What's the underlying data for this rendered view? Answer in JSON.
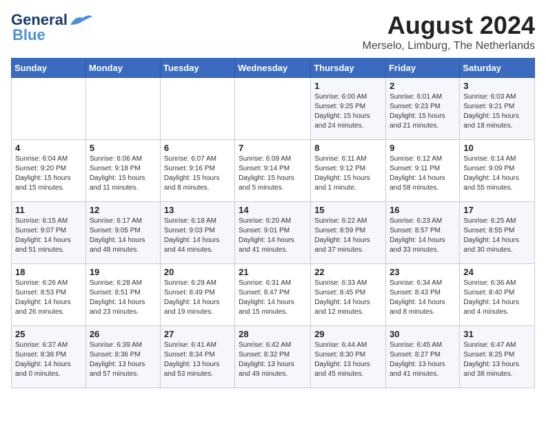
{
  "header": {
    "logo_line1": "General",
    "logo_line2": "Blue",
    "title": "August 2024",
    "subtitle": "Merselo, Limburg, The Netherlands"
  },
  "weekdays": [
    "Sunday",
    "Monday",
    "Tuesday",
    "Wednesday",
    "Thursday",
    "Friday",
    "Saturday"
  ],
  "weeks": [
    [
      {
        "day": "",
        "info": ""
      },
      {
        "day": "",
        "info": ""
      },
      {
        "day": "",
        "info": ""
      },
      {
        "day": "",
        "info": ""
      },
      {
        "day": "1",
        "info": "Sunrise: 6:00 AM\nSunset: 9:25 PM\nDaylight: 15 hours\nand 24 minutes."
      },
      {
        "day": "2",
        "info": "Sunrise: 6:01 AM\nSunset: 9:23 PM\nDaylight: 15 hours\nand 21 minutes."
      },
      {
        "day": "3",
        "info": "Sunrise: 6:03 AM\nSunset: 9:21 PM\nDaylight: 15 hours\nand 18 minutes."
      }
    ],
    [
      {
        "day": "4",
        "info": "Sunrise: 6:04 AM\nSunset: 9:20 PM\nDaylight: 15 hours\nand 15 minutes."
      },
      {
        "day": "5",
        "info": "Sunrise: 6:06 AM\nSunset: 9:18 PM\nDaylight: 15 hours\nand 11 minutes."
      },
      {
        "day": "6",
        "info": "Sunrise: 6:07 AM\nSunset: 9:16 PM\nDaylight: 15 hours\nand 8 minutes."
      },
      {
        "day": "7",
        "info": "Sunrise: 6:09 AM\nSunset: 9:14 PM\nDaylight: 15 hours\nand 5 minutes."
      },
      {
        "day": "8",
        "info": "Sunrise: 6:11 AM\nSunset: 9:12 PM\nDaylight: 15 hours\nand 1 minute."
      },
      {
        "day": "9",
        "info": "Sunrise: 6:12 AM\nSunset: 9:11 PM\nDaylight: 14 hours\nand 58 minutes."
      },
      {
        "day": "10",
        "info": "Sunrise: 6:14 AM\nSunset: 9:09 PM\nDaylight: 14 hours\nand 55 minutes."
      }
    ],
    [
      {
        "day": "11",
        "info": "Sunrise: 6:15 AM\nSunset: 9:07 PM\nDaylight: 14 hours\nand 51 minutes."
      },
      {
        "day": "12",
        "info": "Sunrise: 6:17 AM\nSunset: 9:05 PM\nDaylight: 14 hours\nand 48 minutes."
      },
      {
        "day": "13",
        "info": "Sunrise: 6:18 AM\nSunset: 9:03 PM\nDaylight: 14 hours\nand 44 minutes."
      },
      {
        "day": "14",
        "info": "Sunrise: 6:20 AM\nSunset: 9:01 PM\nDaylight: 14 hours\nand 41 minutes."
      },
      {
        "day": "15",
        "info": "Sunrise: 6:22 AM\nSunset: 8:59 PM\nDaylight: 14 hours\nand 37 minutes."
      },
      {
        "day": "16",
        "info": "Sunrise: 6:23 AM\nSunset: 8:57 PM\nDaylight: 14 hours\nand 33 minutes."
      },
      {
        "day": "17",
        "info": "Sunrise: 6:25 AM\nSunset: 8:55 PM\nDaylight: 14 hours\nand 30 minutes."
      }
    ],
    [
      {
        "day": "18",
        "info": "Sunrise: 6:26 AM\nSunset: 8:53 PM\nDaylight: 14 hours\nand 26 minutes."
      },
      {
        "day": "19",
        "info": "Sunrise: 6:28 AM\nSunset: 8:51 PM\nDaylight: 14 hours\nand 23 minutes."
      },
      {
        "day": "20",
        "info": "Sunrise: 6:29 AM\nSunset: 8:49 PM\nDaylight: 14 hours\nand 19 minutes."
      },
      {
        "day": "21",
        "info": "Sunrise: 6:31 AM\nSunset: 8:47 PM\nDaylight: 14 hours\nand 15 minutes."
      },
      {
        "day": "22",
        "info": "Sunrise: 6:33 AM\nSunset: 8:45 PM\nDaylight: 14 hours\nand 12 minutes."
      },
      {
        "day": "23",
        "info": "Sunrise: 6:34 AM\nSunset: 8:43 PM\nDaylight: 14 hours\nand 8 minutes."
      },
      {
        "day": "24",
        "info": "Sunrise: 6:36 AM\nSunset: 8:40 PM\nDaylight: 14 hours\nand 4 minutes."
      }
    ],
    [
      {
        "day": "25",
        "info": "Sunrise: 6:37 AM\nSunset: 8:38 PM\nDaylight: 14 hours\nand 0 minutes."
      },
      {
        "day": "26",
        "info": "Sunrise: 6:39 AM\nSunset: 8:36 PM\nDaylight: 13 hours\nand 57 minutes."
      },
      {
        "day": "27",
        "info": "Sunrise: 6:41 AM\nSunset: 8:34 PM\nDaylight: 13 hours\nand 53 minutes."
      },
      {
        "day": "28",
        "info": "Sunrise: 6:42 AM\nSunset: 8:32 PM\nDaylight: 13 hours\nand 49 minutes."
      },
      {
        "day": "29",
        "info": "Sunrise: 6:44 AM\nSunset: 8:30 PM\nDaylight: 13 hours\nand 45 minutes."
      },
      {
        "day": "30",
        "info": "Sunrise: 6:45 AM\nSunset: 8:27 PM\nDaylight: 13 hours\nand 41 minutes."
      },
      {
        "day": "31",
        "info": "Sunrise: 6:47 AM\nSunset: 8:25 PM\nDaylight: 13 hours\nand 38 minutes."
      }
    ]
  ]
}
